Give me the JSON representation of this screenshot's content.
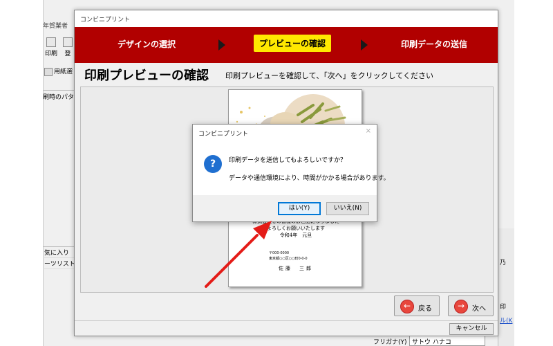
{
  "background_app": {
    "title_fragment": "年賀業者",
    "toolbar": [
      {
        "label": "印刷",
        "icon": "printer-icon"
      },
      {
        "label": "登",
        "icon": "register-icon"
      }
    ],
    "paper_label": "用紙選",
    "pattern_label": "刷時のパタ",
    "favorites": [
      "気に入り",
      "ーツリスト"
    ],
    "right_panel_text1": "乃",
    "right_panel_text2": "印",
    "right_panel_text3": "ル(K",
    "bottom_label": "フリガナ(Y)",
    "bottom_value": "サトウ ハナコ"
  },
  "window": {
    "title": "コンビニプリント",
    "steps": [
      {
        "label": "デザインの選択",
        "active": false
      },
      {
        "label": "プレビューの確認",
        "active": true
      },
      {
        "label": "印刷データの送信",
        "active": false
      }
    ],
    "page_title": "印刷プレビューの確認",
    "instruction": "印刷プレビューを確認して、「次へ」をクリックしてください",
    "card": {
      "lines": [
        "株式会社等の皆様のお世話になりました",
        "よろしくお願いいたします",
        "令和4年　元旦"
      ],
      "address_lines": [
        "〒000-0000",
        "東京都○○区○○町0-0-0"
      ],
      "sender_name": "佐藤　三郎"
    },
    "back_button": "戻る",
    "next_button": "次へ",
    "cancel_button": "キャンセル"
  },
  "dialog": {
    "title": "コンビニプリント",
    "close": "×",
    "icon": "question-icon",
    "message": "印刷データを送信してもよろしいですか？",
    "sub_message": "データや通信環境により、時間がかかる場合があります。",
    "yes_button": "はい(Y)",
    "no_button": "いいえ(N)"
  },
  "colors": {
    "step_bar": "#b10000",
    "active_step": "#ffe800",
    "arrow": "#e41b17",
    "question_icon": "#1f6fd0"
  }
}
